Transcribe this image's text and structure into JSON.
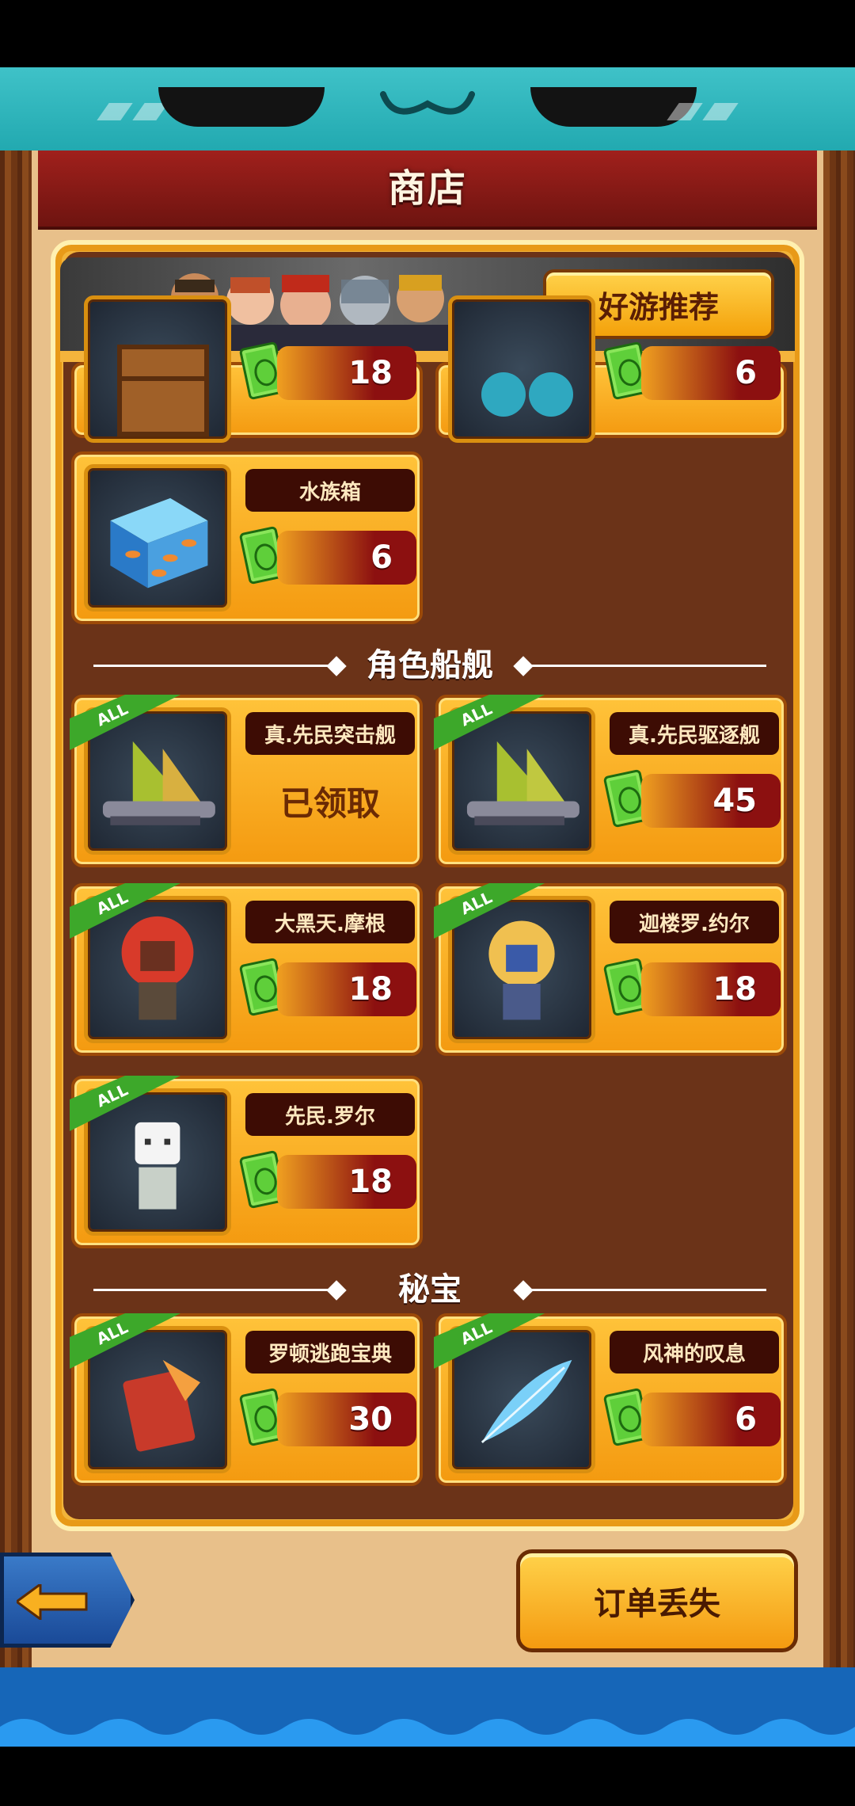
{
  "header": {
    "title": "商店"
  },
  "banner": {
    "button_label": "好游推荐"
  },
  "top_partial": [
    {
      "price": "18"
    },
    {
      "price": "6"
    }
  ],
  "items_general": [
    {
      "name": "水族箱",
      "price": "6",
      "icon": "aquarium-icon"
    }
  ],
  "sections": [
    {
      "label": "角色船舰"
    },
    {
      "label": "秘宝"
    }
  ],
  "role_ships": [
    {
      "name": "真.先民突击舰",
      "price": "",
      "status": "已领取",
      "badge": "ALL",
      "icon": "ship-icon"
    },
    {
      "name": "真.先民驱逐舰",
      "price": "45",
      "status": "",
      "badge": "ALL",
      "icon": "ship-icon"
    },
    {
      "name": "大黑天.摩根",
      "price": "18",
      "status": "",
      "badge": "ALL",
      "icon": "character-icon"
    },
    {
      "name": "迦楼罗.约尔",
      "price": "18",
      "status": "",
      "badge": "ALL",
      "icon": "character-icon"
    },
    {
      "name": "先民.罗尔",
      "price": "18",
      "status": "",
      "badge": "ALL",
      "icon": "character-icon"
    }
  ],
  "treasures": [
    {
      "name": "罗顿逃跑宝典",
      "price": "30",
      "badge": "ALL",
      "icon": "book-icon"
    },
    {
      "name": "风神的叹息",
      "price": "6",
      "badge": "ALL",
      "icon": "feather-icon"
    }
  ],
  "footer": {
    "order_button": "订单丢失"
  },
  "colors": {
    "accent": "#f49a10",
    "title_red": "#a0201c",
    "panel_brown": "#6b3318",
    "teal": "#3fc2c8"
  }
}
